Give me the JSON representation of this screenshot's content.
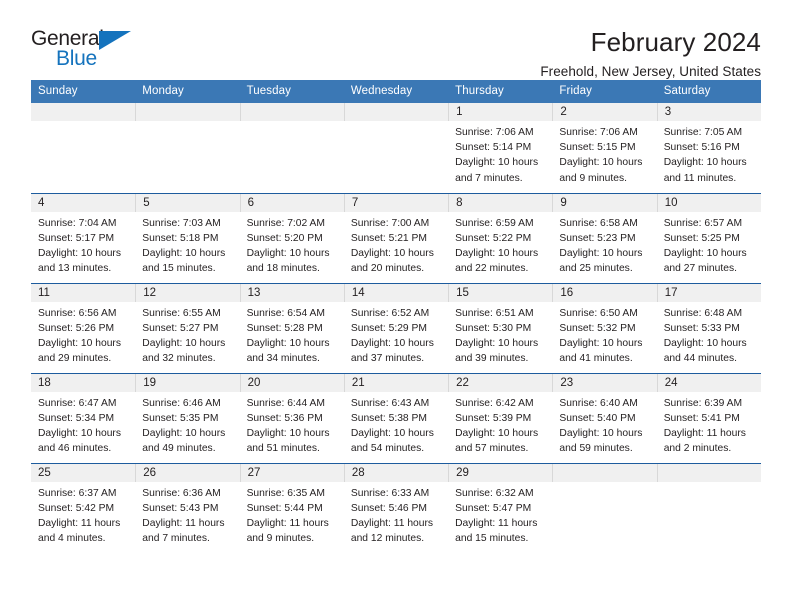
{
  "brand": {
    "name_part1": "General",
    "name_part2": "Blue",
    "triangle_icon": "triangle-icon",
    "accent_color": "#1573bd"
  },
  "header": {
    "title": "February 2024",
    "location": "Freehold, New Jersey, United States",
    "header_bg_color": "#3b78b5",
    "row_border_color": "#1d5c9e",
    "daynum_bg_color": "#f0f0f0"
  },
  "weekday_headers": [
    "Sunday",
    "Monday",
    "Tuesday",
    "Wednesday",
    "Thursday",
    "Friday",
    "Saturday"
  ],
  "labels": {
    "sunrise": "Sunrise:",
    "sunset": "Sunset:",
    "daylight": "Daylight:"
  },
  "weeks": [
    [
      {
        "day": "",
        "empty": true
      },
      {
        "day": "",
        "empty": true
      },
      {
        "day": "",
        "empty": true
      },
      {
        "day": "",
        "empty": true
      },
      {
        "day": "1",
        "sunrise": "Sunrise: 7:06 AM",
        "sunset": "Sunset: 5:14 PM",
        "daylight_l1": "Daylight: 10 hours",
        "daylight_l2": "and 7 minutes."
      },
      {
        "day": "2",
        "sunrise": "Sunrise: 7:06 AM",
        "sunset": "Sunset: 5:15 PM",
        "daylight_l1": "Daylight: 10 hours",
        "daylight_l2": "and 9 minutes."
      },
      {
        "day": "3",
        "sunrise": "Sunrise: 7:05 AM",
        "sunset": "Sunset: 5:16 PM",
        "daylight_l1": "Daylight: 10 hours",
        "daylight_l2": "and 11 minutes."
      }
    ],
    [
      {
        "day": "4",
        "sunrise": "Sunrise: 7:04 AM",
        "sunset": "Sunset: 5:17 PM",
        "daylight_l1": "Daylight: 10 hours",
        "daylight_l2": "and 13 minutes."
      },
      {
        "day": "5",
        "sunrise": "Sunrise: 7:03 AM",
        "sunset": "Sunset: 5:18 PM",
        "daylight_l1": "Daylight: 10 hours",
        "daylight_l2": "and 15 minutes."
      },
      {
        "day": "6",
        "sunrise": "Sunrise: 7:02 AM",
        "sunset": "Sunset: 5:20 PM",
        "daylight_l1": "Daylight: 10 hours",
        "daylight_l2": "and 18 minutes."
      },
      {
        "day": "7",
        "sunrise": "Sunrise: 7:00 AM",
        "sunset": "Sunset: 5:21 PM",
        "daylight_l1": "Daylight: 10 hours",
        "daylight_l2": "and 20 minutes."
      },
      {
        "day": "8",
        "sunrise": "Sunrise: 6:59 AM",
        "sunset": "Sunset: 5:22 PM",
        "daylight_l1": "Daylight: 10 hours",
        "daylight_l2": "and 22 minutes."
      },
      {
        "day": "9",
        "sunrise": "Sunrise: 6:58 AM",
        "sunset": "Sunset: 5:23 PM",
        "daylight_l1": "Daylight: 10 hours",
        "daylight_l2": "and 25 minutes."
      },
      {
        "day": "10",
        "sunrise": "Sunrise: 6:57 AM",
        "sunset": "Sunset: 5:25 PM",
        "daylight_l1": "Daylight: 10 hours",
        "daylight_l2": "and 27 minutes."
      }
    ],
    [
      {
        "day": "11",
        "sunrise": "Sunrise: 6:56 AM",
        "sunset": "Sunset: 5:26 PM",
        "daylight_l1": "Daylight: 10 hours",
        "daylight_l2": "and 29 minutes."
      },
      {
        "day": "12",
        "sunrise": "Sunrise: 6:55 AM",
        "sunset": "Sunset: 5:27 PM",
        "daylight_l1": "Daylight: 10 hours",
        "daylight_l2": "and 32 minutes."
      },
      {
        "day": "13",
        "sunrise": "Sunrise: 6:54 AM",
        "sunset": "Sunset: 5:28 PM",
        "daylight_l1": "Daylight: 10 hours",
        "daylight_l2": "and 34 minutes."
      },
      {
        "day": "14",
        "sunrise": "Sunrise: 6:52 AM",
        "sunset": "Sunset: 5:29 PM",
        "daylight_l1": "Daylight: 10 hours",
        "daylight_l2": "and 37 minutes."
      },
      {
        "day": "15",
        "sunrise": "Sunrise: 6:51 AM",
        "sunset": "Sunset: 5:30 PM",
        "daylight_l1": "Daylight: 10 hours",
        "daylight_l2": "and 39 minutes."
      },
      {
        "day": "16",
        "sunrise": "Sunrise: 6:50 AM",
        "sunset": "Sunset: 5:32 PM",
        "daylight_l1": "Daylight: 10 hours",
        "daylight_l2": "and 41 minutes."
      },
      {
        "day": "17",
        "sunrise": "Sunrise: 6:48 AM",
        "sunset": "Sunset: 5:33 PM",
        "daylight_l1": "Daylight: 10 hours",
        "daylight_l2": "and 44 minutes."
      }
    ],
    [
      {
        "day": "18",
        "sunrise": "Sunrise: 6:47 AM",
        "sunset": "Sunset: 5:34 PM",
        "daylight_l1": "Daylight: 10 hours",
        "daylight_l2": "and 46 minutes."
      },
      {
        "day": "19",
        "sunrise": "Sunrise: 6:46 AM",
        "sunset": "Sunset: 5:35 PM",
        "daylight_l1": "Daylight: 10 hours",
        "daylight_l2": "and 49 minutes."
      },
      {
        "day": "20",
        "sunrise": "Sunrise: 6:44 AM",
        "sunset": "Sunset: 5:36 PM",
        "daylight_l1": "Daylight: 10 hours",
        "daylight_l2": "and 51 minutes."
      },
      {
        "day": "21",
        "sunrise": "Sunrise: 6:43 AM",
        "sunset": "Sunset: 5:38 PM",
        "daylight_l1": "Daylight: 10 hours",
        "daylight_l2": "and 54 minutes."
      },
      {
        "day": "22",
        "sunrise": "Sunrise: 6:42 AM",
        "sunset": "Sunset: 5:39 PM",
        "daylight_l1": "Daylight: 10 hours",
        "daylight_l2": "and 57 minutes."
      },
      {
        "day": "23",
        "sunrise": "Sunrise: 6:40 AM",
        "sunset": "Sunset: 5:40 PM",
        "daylight_l1": "Daylight: 10 hours",
        "daylight_l2": "and 59 minutes."
      },
      {
        "day": "24",
        "sunrise": "Sunrise: 6:39 AM",
        "sunset": "Sunset: 5:41 PM",
        "daylight_l1": "Daylight: 11 hours",
        "daylight_l2": "and 2 minutes."
      }
    ],
    [
      {
        "day": "25",
        "sunrise": "Sunrise: 6:37 AM",
        "sunset": "Sunset: 5:42 PM",
        "daylight_l1": "Daylight: 11 hours",
        "daylight_l2": "and 4 minutes."
      },
      {
        "day": "26",
        "sunrise": "Sunrise: 6:36 AM",
        "sunset": "Sunset: 5:43 PM",
        "daylight_l1": "Daylight: 11 hours",
        "daylight_l2": "and 7 minutes."
      },
      {
        "day": "27",
        "sunrise": "Sunrise: 6:35 AM",
        "sunset": "Sunset: 5:44 PM",
        "daylight_l1": "Daylight: 11 hours",
        "daylight_l2": "and 9 minutes."
      },
      {
        "day": "28",
        "sunrise": "Sunrise: 6:33 AM",
        "sunset": "Sunset: 5:46 PM",
        "daylight_l1": "Daylight: 11 hours",
        "daylight_l2": "and 12 minutes."
      },
      {
        "day": "29",
        "sunrise": "Sunrise: 6:32 AM",
        "sunset": "Sunset: 5:47 PM",
        "daylight_l1": "Daylight: 11 hours",
        "daylight_l2": "and 15 minutes."
      },
      {
        "day": "",
        "empty": true
      },
      {
        "day": "",
        "empty": true
      }
    ]
  ]
}
